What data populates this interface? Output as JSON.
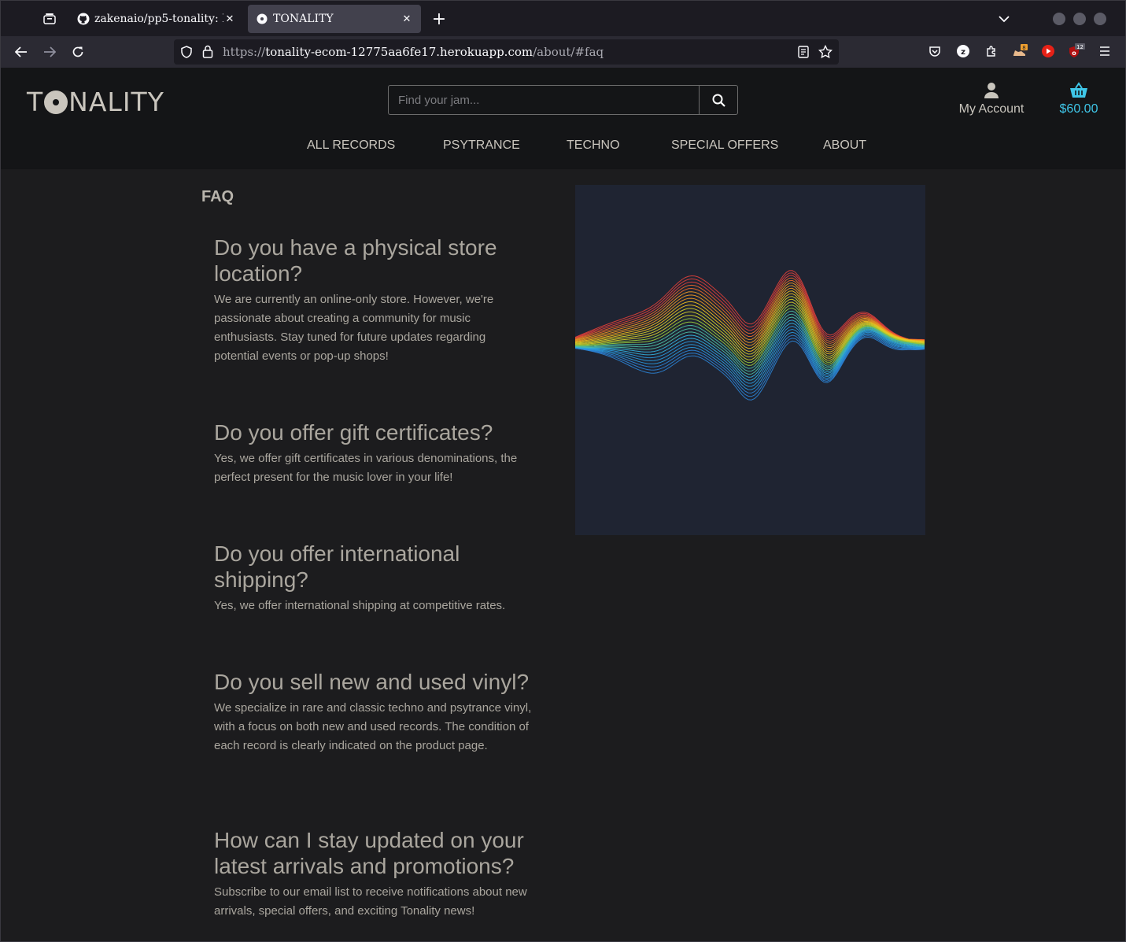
{
  "browser": {
    "tabs": [
      {
        "title": "zakenaio/pp5-tonality: I",
        "active": false,
        "favicon": "github-icon"
      },
      {
        "title": "TONALITY",
        "active": true,
        "favicon": "vinyl-icon"
      }
    ],
    "url": {
      "scheme": "https://",
      "host": "tonality-ecom-12775aa6fe17.herokuapp.com",
      "path": "/about/#faq"
    },
    "extension_badges": {
      "ext_a": "8",
      "ext_b": "12"
    }
  },
  "site": {
    "logo_left": "T",
    "logo_right": "NALITY",
    "search": {
      "placeholder": "Find your jam..."
    },
    "account_label": "My Account",
    "cart_total": "$60.00",
    "nav": [
      "ALL RECORDS",
      "PSYTRANCE",
      "TECHNO",
      "SPECIAL OFFERS",
      "ABOUT"
    ],
    "colors": {
      "accent": "#3fc6e8",
      "text": "#c9c5bd",
      "header_bg": "#141517",
      "page_bg": "#1c1c1e"
    }
  },
  "faq": {
    "heading": "FAQ",
    "items": [
      {
        "question": "Do you have a physical store location?",
        "answer": "We are currently an online-only store. However, we're passionate about creating a community for music enthusiasts. Stay tuned for future updates regarding potential events or pop-up shops!"
      },
      {
        "question": "Do you offer gift certificates?",
        "answer": "Yes, we offer gift certificates in various denominations, the perfect present for the music lover in your life!"
      },
      {
        "question": "Do you offer international shipping?",
        "answer": "Yes, we offer international shipping at competitive rates."
      },
      {
        "question": "Do you sell new and used vinyl?",
        "answer": "We specialize in rare and classic techno and psytrance vinyl, with a focus on both new and used records. The condition of each record is clearly indicated on the product page."
      },
      {
        "question": "How can I stay updated on your latest arrivals and promotions?",
        "answer": "Subscribe to our email list to receive notifications about new arrivals, special offers, and exciting Tonality news!"
      }
    ]
  }
}
